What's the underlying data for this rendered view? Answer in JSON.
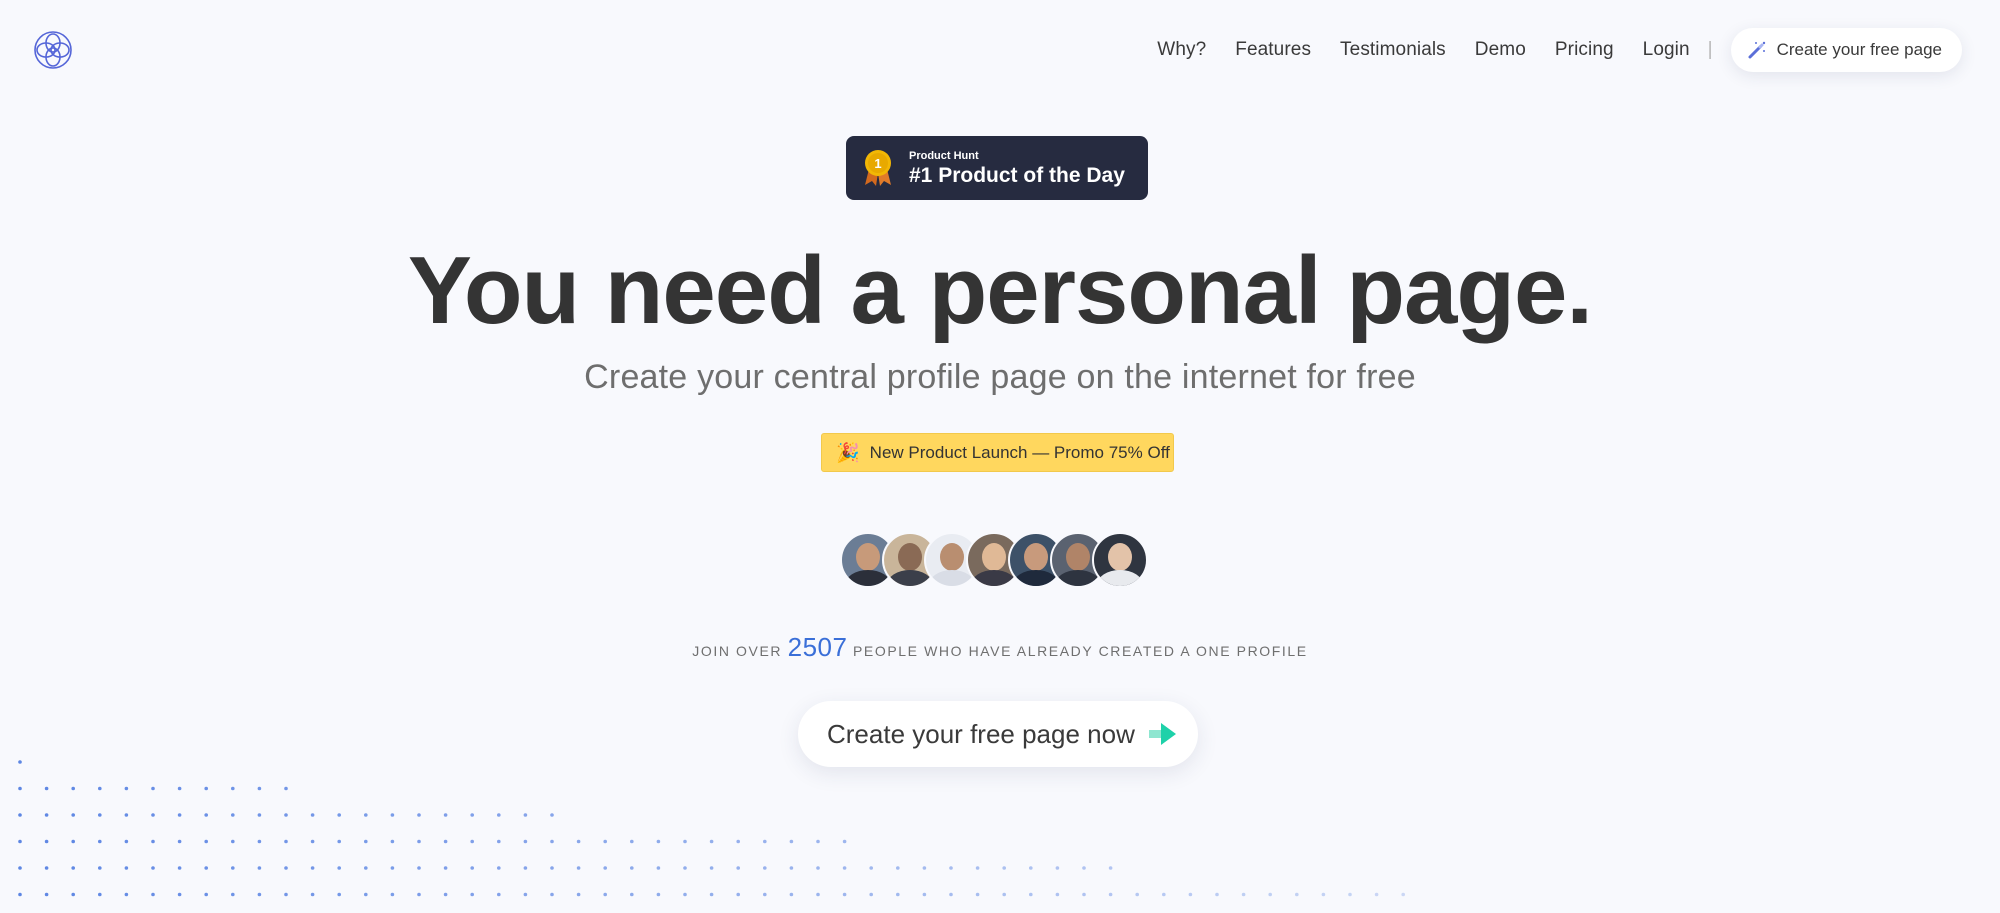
{
  "header": {
    "nav": [
      "Why?",
      "Features",
      "Testimonials",
      "Demo",
      "Pricing",
      "Login"
    ],
    "separator": "|",
    "cta_label": "Create your free page"
  },
  "badge": {
    "small": "Product Hunt",
    "big": "#1 Product of the Day",
    "rank": "1"
  },
  "hero": {
    "title": "You need a personal page.",
    "subtitle": "Create your central profile page on the internet for free"
  },
  "promo": {
    "emoji": "🎉",
    "label": "New Product Launch — Promo 75% Off"
  },
  "social": {
    "join_prefix": "JOIN OVER",
    "count": "2507",
    "join_suffix": "PEOPLE WHO HAVE ALREADY CREATED A ONE PROFILE"
  },
  "cta": {
    "label": "Create your free page now"
  },
  "colors": {
    "background": "#f8f9fd",
    "accent_blue": "#3a6fd8",
    "promo_yellow": "#ffd75e",
    "badge_dark": "#262b40",
    "arrow_teal": "#1ed1a9"
  }
}
